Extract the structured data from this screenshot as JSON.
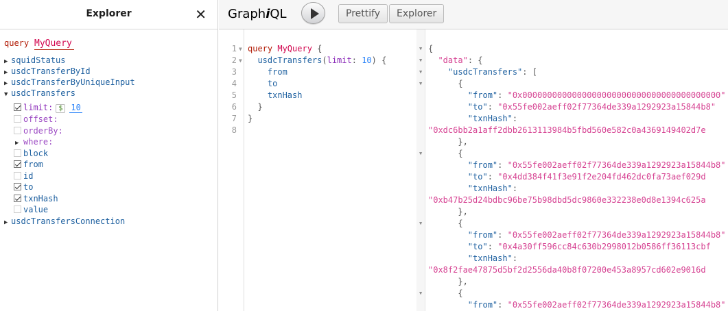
{
  "explorer": {
    "title": "Explorer",
    "close_glyph": "✕",
    "query_keyword": "query",
    "query_name": "MyQuery",
    "items": {
      "squidStatus": "squidStatus",
      "usdcTransferById": "usdcTransferById",
      "usdcTransferByUniqueInput": "usdcTransferByUniqueInput",
      "usdcTransfers": "usdcTransfers",
      "limit_label": "limit:",
      "limit_value": "10",
      "offset_label": "offset:",
      "orderBy_label": "orderBy:",
      "where_label": "where:",
      "block": "block",
      "from": "from",
      "id": "id",
      "to": "to",
      "txnHash": "txnHash",
      "value": "value",
      "usdcTransfersConnection": "usdcTransfersConnection"
    },
    "dollar": "$"
  },
  "toolbar": {
    "logo_pre": "Graph",
    "logo_i": "i",
    "logo_post": "QL",
    "prettify": "Prettify",
    "explorer": "Explorer"
  },
  "editor": {
    "line_numbers": [
      "1",
      "2",
      "3",
      "4",
      "5",
      "6",
      "7",
      "8"
    ],
    "kw_query": "query",
    "op_name": "MyQuery",
    "open_brace": " {",
    "field": "usdcTransfers",
    "arg_open": "(",
    "arg_name": "limit",
    "arg_colon": ": ",
    "arg_value": "10",
    "arg_close": ") {",
    "f_from": "from",
    "f_to": "to",
    "f_txnHash": "txnHash",
    "close_inner": "}",
    "close_outer": "}"
  },
  "result": {
    "l1": "{",
    "data_key": "\"data\"",
    "data_rest": ": {",
    "ut_key": "\"usdcTransfers\"",
    "ut_rest": ": [",
    "obj_open": "{",
    "obj_close": "},",
    "k_from": "\"from\"",
    "k_to": "\"to\"",
    "k_txn": "\"txnHash\"",
    "colon": ": ",
    "colon_only": ":",
    "r1_from": "\"0x0000000000000000000000000000000000000000\"",
    "r1_to": "\"0x55fe002aeff02f77364de339a1292923a15844b8\"",
    "r1_txn": "\"0xdc6bb2a1aff2dbb2613113984b5fbd560e582c0a4369149402d7e",
    "r2_from": "\"0x55fe002aeff02f77364de339a1292923a15844b8\"",
    "r2_to": "\"0x4dd384f41f3e91f2e204fd462dc0fa73aef029d",
    "r2_txn": "\"0xb47b25d24bdbc96be75b98dbd5dc9860e332238e0d8e1394c625a",
    "r3_from": "\"0x55fe002aeff02f77364de339a1292923a15844b8\"",
    "r3_to": "\"0x4a30ff596cc84c630b2998012b0586ff36113cbf",
    "r3_txn": "\"0x8f2fae47875d5bf2d2556da40b8f07200e453a8957cd602e9016d",
    "r4_from": "\"0x55fe002aeff02f77364de339a1292923a15844b8\""
  }
}
